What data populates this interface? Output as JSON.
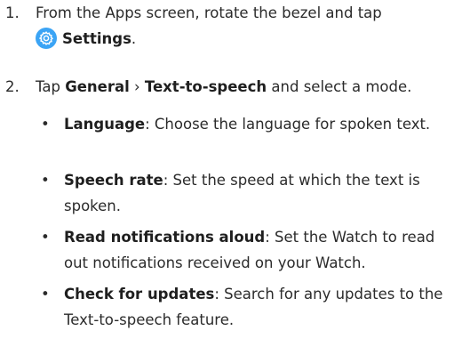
{
  "steps": [
    {
      "number": "1.",
      "text_before": "From the Apps screen, rotate the bezel and tap",
      "icon": "settings-gear-icon",
      "strong": "Settings",
      "text_after": "."
    },
    {
      "number": "2.",
      "text_before": "Tap",
      "strong1": "General",
      "separator": "›",
      "strong2": "Text-to-speech",
      "text_after": "and select a mode."
    }
  ],
  "bullets": [
    {
      "dot": "•",
      "term": "Language",
      "desc": ": Choose the language for spoken text."
    },
    {
      "dot": "•",
      "term": "Speech rate",
      "desc": ": Set the speed at which the text is spoken."
    },
    {
      "dot": "•",
      "term": "Read notifications aloud",
      "desc": ": Set the Watch to read out notifications received on your Watch."
    },
    {
      "dot": "•",
      "term": "Check for updates",
      "desc": ": Search for any updates to the Text-to-speech feature."
    }
  ],
  "colors": {
    "text": "#2b2b2b",
    "icon_bg": "#3ba4f5",
    "icon_fg": "#ffffff"
  }
}
